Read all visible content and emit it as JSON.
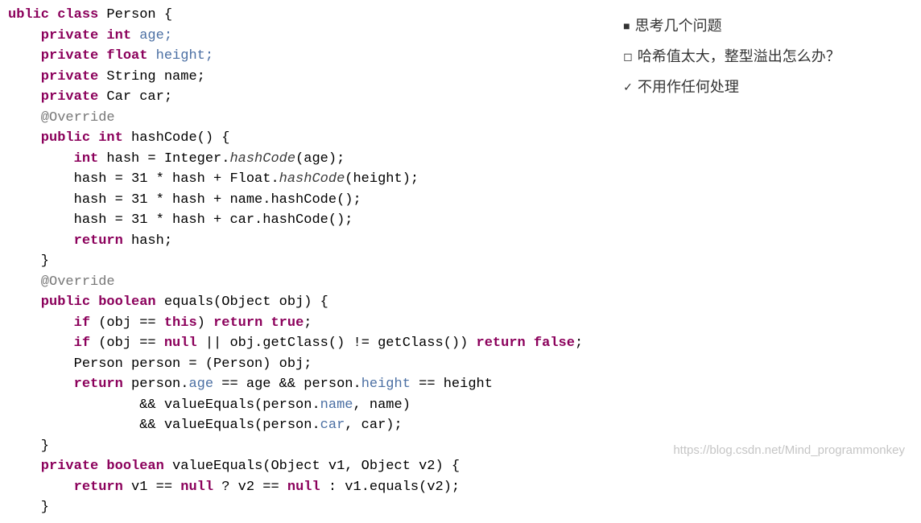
{
  "code": {
    "l1": "ublic class ",
    "l1b": "Person {",
    "l2a": "    private int ",
    "l2b": "age;",
    "l3a": "    private float ",
    "l3b": "height;",
    "l4a": "    private ",
    "l4b": "String name;",
    "l5a": "    private ",
    "l5b": "Car car;",
    "l6": "    @Override",
    "l7a": "    public int ",
    "l7b": "hashCode() {",
    "l8a": "        int ",
    "l8b": "hash = Integer.",
    "l8c": "hashCode",
    "l8d": "(age);",
    "l9a": "        hash = 31 * hash + Float.",
    "l9b": "hashCode",
    "l9c": "(height);",
    "l10": "        hash = 31 * hash + name.hashCode();",
    "l11": "        hash = 31 * hash + car.hashCode();",
    "l12a": "        return ",
    "l12b": "hash;",
    "l13": "    }",
    "l14": "    @Override",
    "l15a": "    public boolean ",
    "l15b": "equals(Object obj) {",
    "l16a": "        if ",
    "l16b": "(obj == ",
    "l16c": "this",
    "l16d": ") ",
    "l16e": "return true",
    "l16f": ";",
    "l17a": "        if ",
    "l17b": "(obj == ",
    "l17c": "null ",
    "l17d": "|| obj.getClass() != getClass()) ",
    "l17e": "return false",
    "l17f": ";",
    "l18": "        Person person = (Person) obj;",
    "l19a": "        return ",
    "l19b": "person.",
    "l19c": "age ",
    "l19d": "== age && person.",
    "l19e": "height ",
    "l19f": "== height",
    "l20a": "                && valueEquals(person.",
    "l20b": "name",
    "l20c": ", name)",
    "l21a": "                && valueEquals(person.",
    "l21b": "car",
    "l21c": ", car);",
    "l22": "    }",
    "l23a": "    private boolean ",
    "l23b": "valueEquals(Object v1, Object v2) {",
    "l24a": "        return ",
    "l24b": "v1 == ",
    "l24c": "null ",
    "l24d": "? v2 == ",
    "l24e": "null ",
    "l24f": ": v1.equals(v2);",
    "l25": "    }"
  },
  "notes": {
    "n1": "思考几个问题",
    "n2": "哈希值太大，整型溢出怎么办？",
    "n3": "不用作任何处理"
  },
  "bullets": {
    "b1": "■",
    "b2": "◻",
    "b3": "✓"
  },
  "watermark_url": "https://blog.csdn.net/Mind_programmonkey"
}
